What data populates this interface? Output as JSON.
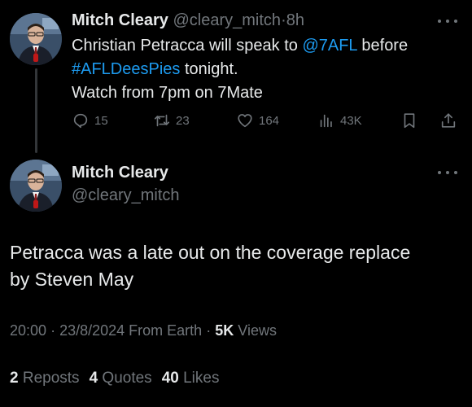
{
  "reply_tweet": {
    "author_name": "Mitch Cleary",
    "handle": "@cleary_mitch",
    "separator": "·",
    "time_ago": "8h",
    "text_part1": "Christian Petracca will speak to ",
    "mention": "@7AFL",
    "text_part2": " before",
    "hashtag": "#AFLDeesPies",
    "text_part3": " tonight.",
    "text_line3": "Watch from 7pm on 7Mate",
    "actions": {
      "replies": "15",
      "reposts": "23",
      "likes": "164",
      "views": "43K"
    }
  },
  "main_tweet": {
    "author_name": "Mitch Cleary",
    "handle": "@cleary_mitch",
    "text_line1": "Petracca was a late out on the coverage replace",
    "text_line2": "by Steven May",
    "time": "20:00",
    "dot1": "·",
    "date": "23/8/2024",
    "source": "From Earth",
    "dot2": "·",
    "views_count": "5K",
    "views_label": "Views",
    "reposts_count": "2",
    "reposts_label": "Reposts",
    "quotes_count": "4",
    "quotes_label": "Quotes",
    "likes_count": "40",
    "likes_label": "Likes"
  },
  "colors": {
    "background": "#000000",
    "text": "#e7e9ea",
    "muted": "#71767b",
    "link": "#1d9bf0"
  }
}
